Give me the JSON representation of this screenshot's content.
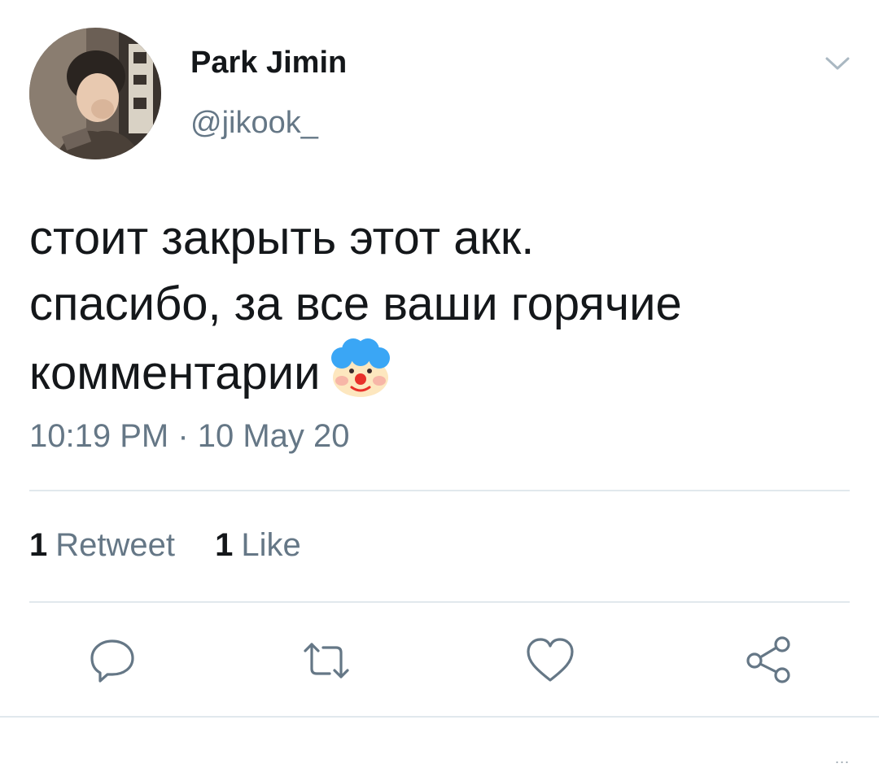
{
  "tweet": {
    "author": {
      "display_name": "Park Jimin",
      "handle": "@jikook_"
    },
    "text_lines": [
      "стоит закрыть этот акк.",
      "спасибо, за все ваши горячие",
      "комментарии"
    ],
    "emoji": "clown-face",
    "timestamp": "10:19 PM · 10 May 20",
    "stats": {
      "retweet_count": "1",
      "retweet_label": "Retweet",
      "like_count": "1",
      "like_label": "Like"
    }
  },
  "icons": {
    "menu": "chevron-down-icon",
    "reply": "reply-icon",
    "retweet": "retweet-icon",
    "like": "heart-icon",
    "share": "share-icon"
  },
  "colors": {
    "text_primary": "#14171a",
    "text_secondary": "#657786",
    "divider": "#e1e8ed"
  },
  "footer": {
    "overflow": "..."
  }
}
